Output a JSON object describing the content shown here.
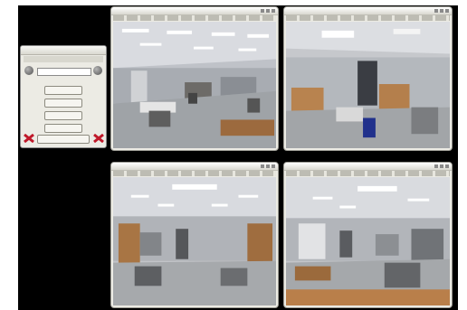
{
  "desktop": {
    "background_color": "#000000"
  },
  "control_panel": {
    "icons": [
      "camera-icon",
      "camera-icon"
    ],
    "buttons": [
      "",
      "",
      "",
      ""
    ],
    "status_button": "",
    "close_icon_color": "#c0192a"
  },
  "camera_windows": [
    {
      "name": "camera-top-left"
    },
    {
      "name": "camera-top-right"
    },
    {
      "name": "camera-bottom-left"
    },
    {
      "name": "camera-bottom-right"
    }
  ]
}
